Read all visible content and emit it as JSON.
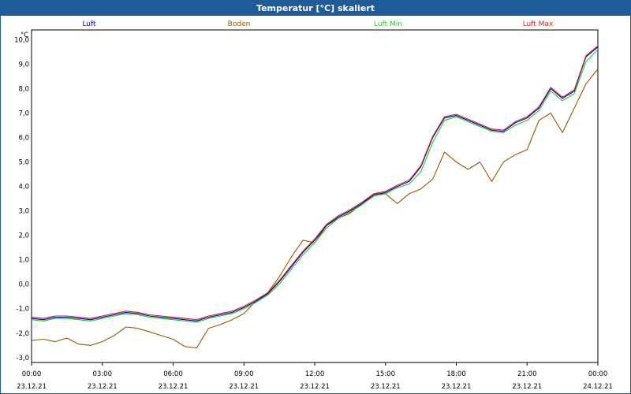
{
  "window": {
    "title": "Temperatur [°C] skaliert"
  },
  "chart_data": {
    "type": "line",
    "title": "Temperatur [°C] skaliert",
    "ylabel": "°C",
    "xlabel": "",
    "ylim": [
      -3.2,
      10.4
    ],
    "xlim": [
      0,
      24
    ],
    "grid": true,
    "legend_placement": "top",
    "y_ticks": [
      "10,0",
      "9,0",
      "8,0",
      "7,0",
      "6,0",
      "5,0",
      "4,0",
      "3,0",
      "2,0",
      "1,0",
      "0,0",
      "-1,0",
      "-2,0",
      "-3,0"
    ],
    "y_tick_values": [
      10,
      9,
      8,
      7,
      6,
      5,
      4,
      3,
      2,
      1,
      0,
      -1,
      -2,
      -3
    ],
    "x_ticks": [
      {
        "x": 0,
        "time": "00:00",
        "date": "23.12.21"
      },
      {
        "x": 3,
        "time": "03:00",
        "date": "23.12.21"
      },
      {
        "x": 6,
        "time": "06:00",
        "date": "23.12.21"
      },
      {
        "x": 9,
        "time": "09:00",
        "date": "23.12.21"
      },
      {
        "x": 12,
        "time": "12:00",
        "date": "23.12.21"
      },
      {
        "x": 15,
        "time": "15:00",
        "date": "23.12.21"
      },
      {
        "x": 18,
        "time": "18:00",
        "date": "23.12.21"
      },
      {
        "x": 21,
        "time": "21:00",
        "date": "23.12.21"
      },
      {
        "x": 24,
        "time": "00:00",
        "date": "24.12.21"
      }
    ],
    "series": [
      {
        "name": "Luft",
        "color": "#0000cc",
        "x": [
          0,
          0.5,
          1,
          1.5,
          2,
          2.5,
          3,
          3.5,
          4,
          4.5,
          5,
          5.5,
          6,
          6.5,
          7,
          7.5,
          8,
          8.5,
          9,
          9.5,
          10,
          10.5,
          11,
          11.5,
          12,
          12.5,
          13,
          13.5,
          14,
          14.5,
          15,
          15.5,
          16,
          16.5,
          17,
          17.5,
          18,
          18.5,
          19,
          19.5,
          20,
          20.5,
          21,
          21.5,
          22,
          22.5,
          23,
          23.5,
          24
        ],
        "values": [
          -1.4,
          -1.45,
          -1.35,
          -1.35,
          -1.4,
          -1.45,
          -1.35,
          -1.25,
          -1.15,
          -1.2,
          -1.3,
          -1.35,
          -1.4,
          -1.45,
          -1.5,
          -1.35,
          -1.25,
          -1.15,
          -0.95,
          -0.7,
          -0.4,
          0.1,
          0.7,
          1.3,
          1.8,
          2.4,
          2.75,
          3.0,
          3.3,
          3.65,
          3.75,
          4.0,
          4.2,
          4.8,
          6.0,
          6.8,
          6.9,
          6.7,
          6.5,
          6.3,
          6.25,
          6.6,
          6.8,
          7.2,
          8.0,
          7.6,
          7.9,
          9.3,
          9.7
        ]
      },
      {
        "name": "Boden",
        "color": "#995500",
        "x": [
          0,
          0.5,
          1,
          1.5,
          2,
          2.5,
          3,
          3.5,
          4,
          4.5,
          5,
          5.5,
          6,
          6.5,
          7,
          7.5,
          8,
          8.5,
          9,
          9.5,
          10,
          10.5,
          11,
          11.5,
          12,
          12.5,
          13,
          13.5,
          14,
          14.5,
          15,
          15.5,
          16,
          16.5,
          17,
          17.5,
          18,
          18.5,
          19,
          19.5,
          20,
          20.5,
          21,
          21.5,
          22,
          22.5,
          23,
          23.5,
          24
        ],
        "values": [
          -2.3,
          -2.25,
          -2.35,
          -2.2,
          -2.45,
          -2.5,
          -2.35,
          -2.1,
          -1.75,
          -1.8,
          -1.95,
          -2.1,
          -2.25,
          -2.55,
          -2.6,
          -1.8,
          -1.65,
          -1.45,
          -1.2,
          -0.7,
          -0.35,
          0.3,
          1.1,
          1.8,
          1.7,
          2.4,
          2.7,
          2.9,
          3.3,
          3.7,
          3.7,
          3.3,
          3.7,
          3.9,
          4.3,
          5.4,
          5.0,
          4.7,
          5.0,
          4.2,
          5.0,
          5.3,
          5.5,
          6.7,
          7.0,
          6.2,
          7.2,
          8.2,
          8.8
        ]
      },
      {
        "name": "Luft Min",
        "color": "#22cc22",
        "x": [
          0,
          0.5,
          1,
          1.5,
          2,
          2.5,
          3,
          3.5,
          4,
          4.5,
          5,
          5.5,
          6,
          6.5,
          7,
          7.5,
          8,
          8.5,
          9,
          9.5,
          10,
          10.5,
          11,
          11.5,
          12,
          12.5,
          13,
          13.5,
          14,
          14.5,
          15,
          15.5,
          16,
          16.5,
          17,
          17.5,
          18,
          18.5,
          19,
          19.5,
          20,
          20.5,
          21,
          21.5,
          22,
          22.5,
          23,
          23.5,
          24
        ],
        "values": [
          -1.45,
          -1.5,
          -1.4,
          -1.4,
          -1.45,
          -1.5,
          -1.4,
          -1.3,
          -1.2,
          -1.25,
          -1.35,
          -1.4,
          -1.45,
          -1.5,
          -1.55,
          -1.4,
          -1.3,
          -1.2,
          -1.0,
          -0.75,
          -0.45,
          0.0,
          0.6,
          1.2,
          1.7,
          2.3,
          2.7,
          2.95,
          3.25,
          3.6,
          3.7,
          3.95,
          4.1,
          4.6,
          5.8,
          6.7,
          6.85,
          6.65,
          6.45,
          6.25,
          6.2,
          6.5,
          6.7,
          7.1,
          7.9,
          7.5,
          7.8,
          9.1,
          9.6
        ]
      },
      {
        "name": "Luft Max",
        "color": "#cc2222",
        "x": [
          0,
          0.5,
          1,
          1.5,
          2,
          2.5,
          3,
          3.5,
          4,
          4.5,
          5,
          5.5,
          6,
          6.5,
          7,
          7.5,
          8,
          8.5,
          9,
          9.5,
          10,
          10.5,
          11,
          11.5,
          12,
          12.5,
          13,
          13.5,
          14,
          14.5,
          15,
          15.5,
          16,
          16.5,
          17,
          17.5,
          18,
          18.5,
          19,
          19.5,
          20,
          20.5,
          21,
          21.5,
          22,
          22.5,
          23,
          23.5,
          24
        ],
        "values": [
          -1.35,
          -1.4,
          -1.3,
          -1.3,
          -1.35,
          -1.4,
          -1.3,
          -1.2,
          -1.1,
          -1.15,
          -1.25,
          -1.3,
          -1.35,
          -1.4,
          -1.45,
          -1.3,
          -1.2,
          -1.1,
          -0.9,
          -0.65,
          -0.35,
          0.15,
          0.75,
          1.35,
          1.85,
          2.45,
          2.8,
          3.05,
          3.35,
          3.7,
          3.8,
          4.05,
          4.25,
          4.85,
          6.05,
          6.85,
          6.95,
          6.75,
          6.55,
          6.35,
          6.3,
          6.65,
          6.85,
          7.25,
          8.05,
          7.65,
          7.95,
          9.35,
          9.75
        ]
      }
    ]
  }
}
